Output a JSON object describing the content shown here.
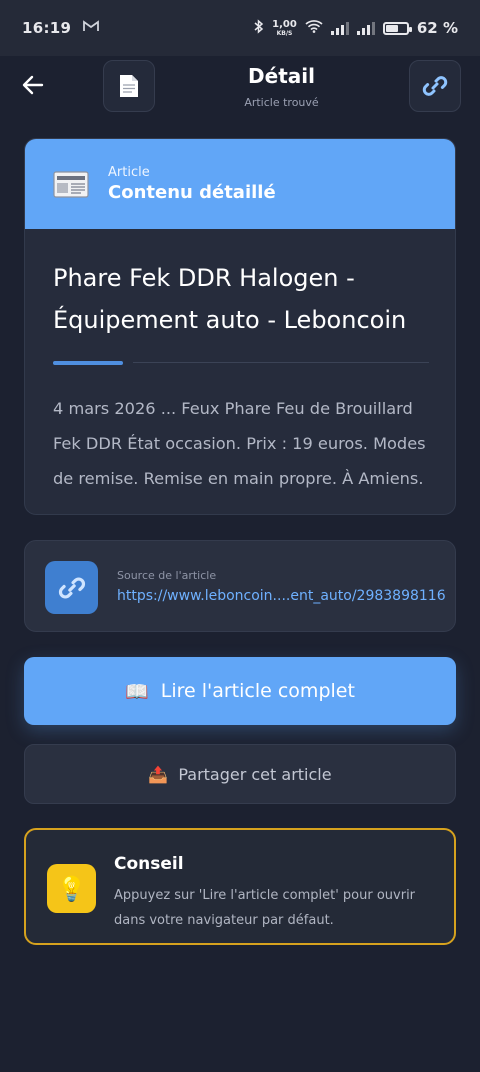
{
  "status_bar": {
    "time": "16:19",
    "mail_icon": "gmail-icon",
    "net_speed_value": "1,00",
    "net_speed_unit": "KB/S",
    "battery_percent": 62,
    "battery_label": "62 %"
  },
  "header": {
    "title": "Détail",
    "subtitle": "Article trouvé",
    "back_icon": "arrow-left-icon",
    "doc_icon": "document-icon",
    "link_icon": "link-icon"
  },
  "article": {
    "kicker": "Article",
    "card_title": "Contenu détaillé",
    "headline": "Phare Fek DDR Halogen - Équipement auto - Leboncoin",
    "snippet": "4 mars 2026 ... Feux Phare Feu de Brouillard Fek DDR État occasion. Prix : 19 euros. Modes de remise. Remise en main propre. À Amiens."
  },
  "source": {
    "label": "Source de l'article",
    "url": "https://www.leboncoin....ent_auto/2983898116"
  },
  "actions": {
    "read_label": "Lire l'article complet",
    "read_icon": "📖",
    "share_label": "Partager cet article",
    "share_icon": "📤"
  },
  "tip": {
    "title": "Conseil",
    "text": "Appuyez sur 'Lire l'article complet' pour ouvrir dans votre navigateur par défaut.",
    "icon": "💡"
  },
  "colors": {
    "background": "#1c2130",
    "accent_blue": "#61a6f7",
    "link_blue": "#6fb1ff",
    "tip_border": "#d6a21e",
    "tip_icon_bg": "#f5c518"
  }
}
